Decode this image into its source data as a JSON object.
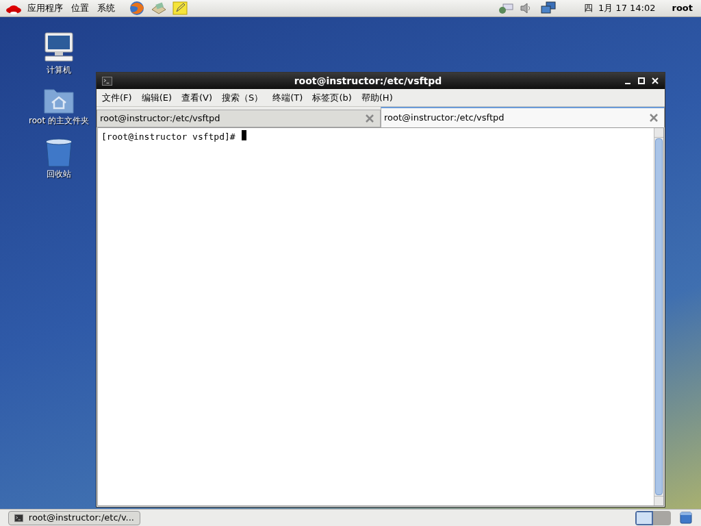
{
  "top_panel": {
    "menus": [
      "应用程序",
      "位置",
      "系统"
    ],
    "clock": "四  1月 17 14:02",
    "user": "root"
  },
  "desktop_icons": [
    {
      "kind": "computer",
      "label": "计算机"
    },
    {
      "kind": "home",
      "label": "root 的主文件夹"
    },
    {
      "kind": "trash",
      "label": "回收站"
    }
  ],
  "window": {
    "title": "root@instructor:/etc/vsftpd",
    "menu": [
      "文件(F)",
      "编辑(E)",
      "查看(V)",
      "搜索（S）",
      "终端(T)",
      "标签页(b)",
      "帮助(H)"
    ],
    "tabs": [
      {
        "label": "root@instructor:/etc/vsftpd",
        "selected": false
      },
      {
        "label": "root@instructor:/etc/vsftpd",
        "selected": true
      }
    ],
    "prompt": "[root@instructor vsftpd]#"
  },
  "taskbar": {
    "items": [
      {
        "label": "root@instructor:/etc/v...",
        "selected": false
      }
    ],
    "workspaces": [
      {
        "selected": true
      },
      {
        "selected": false
      }
    ]
  }
}
